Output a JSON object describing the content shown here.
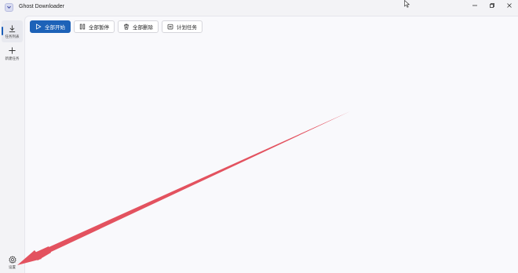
{
  "window": {
    "title": "Ghost Downloader"
  },
  "sidebar": {
    "items": [
      {
        "label": "任务列表",
        "icon": "download-icon",
        "active": true
      },
      {
        "label": "新建任务",
        "icon": "plus-icon",
        "active": false
      }
    ],
    "settings": {
      "label": "设置",
      "icon": "gear-icon"
    }
  },
  "toolbar": {
    "start_all": "全部开始",
    "pause_all": "全部暂停",
    "delete_all": "全部删除",
    "schedule": "计划任务"
  },
  "colors": {
    "accent": "#1d62b8",
    "annotation_arrow": "#e3525f"
  }
}
